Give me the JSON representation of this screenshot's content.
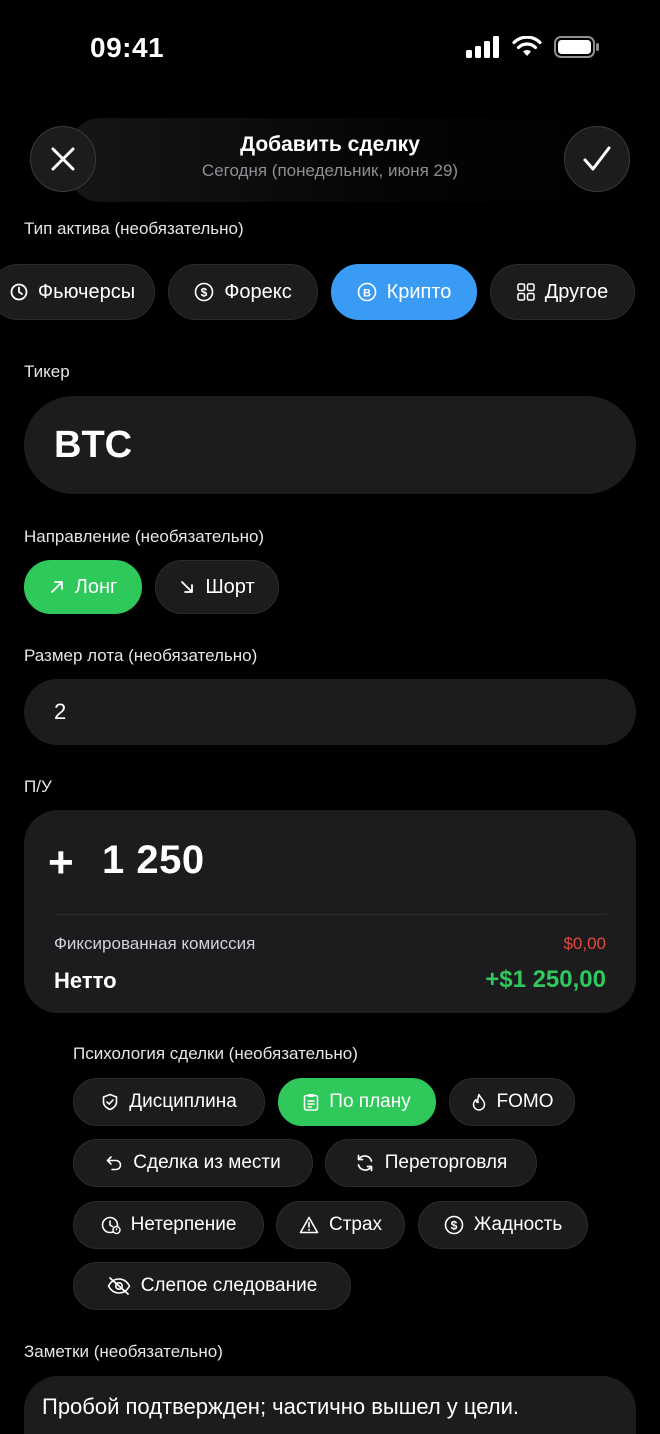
{
  "status": {
    "time": "09:41"
  },
  "header": {
    "title": "Добавить сделку",
    "subtitle": "Сегодня (понедельник, июня 29)"
  },
  "asset_type": {
    "label": "Тип актива (необязательно)",
    "options": [
      {
        "label": "Фьючерсы",
        "icon": "clock-icon"
      },
      {
        "label": "Форекс",
        "icon": "dollar-icon"
      },
      {
        "label": "Крипто",
        "icon": "bitcoin-icon",
        "selected": true
      },
      {
        "label": "Другое",
        "icon": "grid-icon"
      }
    ]
  },
  "ticker": {
    "label": "Тикер",
    "value": "BTC"
  },
  "direction": {
    "label": "Направление (необязательно)",
    "options": [
      {
        "label": "Лонг",
        "icon": "arrow-up-right-icon",
        "selected": true
      },
      {
        "label": "Шорт",
        "icon": "arrow-down-right-icon"
      }
    ]
  },
  "lot_size": {
    "label": "Размер лота (необязательно)",
    "value": "2"
  },
  "pnl": {
    "label": "П/У",
    "sign": "+",
    "value": "1 250",
    "fee_label": "Фиксированная комиссия",
    "fee_value": "$0,00",
    "net_label": "Нетто",
    "net_value": "+$1 250,00"
  },
  "psychology": {
    "label": "Психология сделки (необязательно)",
    "tags": [
      {
        "label": "Дисциплина",
        "icon": "shield-check-icon"
      },
      {
        "label": "По плану",
        "icon": "clipboard-icon",
        "selected": true
      },
      {
        "label": "FOMO",
        "icon": "flame-icon"
      },
      {
        "label": "Сделка из мести",
        "icon": "undo-icon"
      },
      {
        "label": "Переторговля",
        "icon": "refresh-icon"
      },
      {
        "label": "Нетерпение",
        "icon": "clock-alert-icon"
      },
      {
        "label": "Страх",
        "icon": "warning-icon"
      },
      {
        "label": "Жадность",
        "icon": "dollar-icon"
      },
      {
        "label": "Слепое следование",
        "icon": "eye-off-icon"
      }
    ]
  },
  "notes": {
    "label": "Заметки (необязательно)",
    "value": "Пробой подтвержден; частично вышел у цели."
  },
  "colors": {
    "accent_blue": "#3a9bf5",
    "accent_green": "#2fc85b",
    "negative": "#e5483f",
    "positive": "#30c85e"
  }
}
